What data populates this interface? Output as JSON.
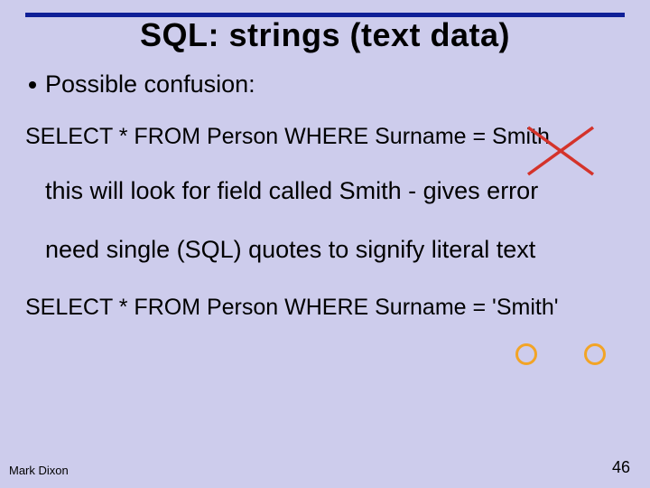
{
  "title": "SQL: strings (text data)",
  "bullet1": "Possible confusion:",
  "sql_wrong": "SELECT * FROM Person WHERE Surname = Smith",
  "explain1": "this will look for field called Smith - gives error",
  "explain2": "need single (SQL) quotes to signify literal text",
  "sql_right": "SELECT * FROM Person WHERE Surname = 'Smith'",
  "footer_author": "Mark Dixon",
  "footer_page": "46",
  "annotations": {
    "cross_color": "#d4332b",
    "circle_color": "#f2a426"
  }
}
